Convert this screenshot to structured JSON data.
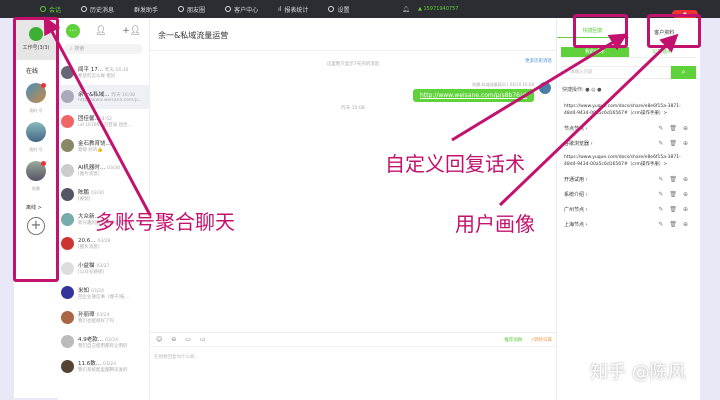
{
  "topbar": {
    "nav": [
      "会话",
      "历史消息",
      "群发助手",
      "朋友圈",
      "客户中心",
      "报表统计",
      "设置"
    ],
    "user": "15971940757"
  },
  "accounts": {
    "title": "工作号(3/3)",
    "online": "在线",
    "items": [
      "我的-号",
      "我的-号",
      "陈鹏"
    ],
    "more": "离线 >"
  },
  "contacts": {
    "search_placeholder": "搜索",
    "items": [
      {
        "name": "闻平 17...",
        "time": "昨天 16:30",
        "msg": "希望的怎么样 挺好"
      },
      {
        "name": "余一&私域...",
        "time": "昨天 16:08",
        "msg": "http://www.weisane.com/p..."
      },
      {
        "name": "团佳馨...",
        "time": "4:52",
        "msg": "ud 16166...已登录 团佳..."
      },
      {
        "name": "金石教育饶...",
        "time": "",
        "msg": "嗯嗯 好的👍"
      },
      {
        "name": "AI机器时...",
        "time": "03/30",
        "msg": "[图片消息]"
      },
      {
        "name": "陈鹏",
        "time": "03/30",
        "msg": "[视频]"
      },
      {
        "name": "大众新...",
        "time": "",
        "msg": "新兴趣的这类我可以无成功"
      },
      {
        "name": "20.6...",
        "time": "03/28",
        "msg": "[图片消息]"
      },
      {
        "name": "小益猫",
        "time": "03/27",
        "msg": "[公众号链接]"
      },
      {
        "name": "米知",
        "time": "03/24",
        "msg": "回企业微信事（端子/拓..."
      },
      {
        "name": "孙丽璋",
        "time": "03/24",
        "msg": "我们也挺很好了吗"
      },
      {
        "name": "4.9老款...",
        "time": "03/24",
        "msg": "我们自己使用都有让用的"
      },
      {
        "name": "11.6数...",
        "time": "03/24",
        "msg": "我们系统能里都腾讯发的"
      }
    ]
  },
  "chat": {
    "title": "余一&私域流量运营",
    "sys1": "这里暂只显示7天内的消息",
    "more": "更多历史消息",
    "sender": "陈鹏-私域流量顾问 | 04/20 16:08",
    "bubble": "http://www.weisane.com/p/s8b76/#",
    "sys2": "昨天 15:08",
    "recommend": "推荐加群",
    "transfer": "↗转移归属",
    "input_placeholder": "在想要回复你什么呢..."
  },
  "panel": {
    "tabs": [
      "快捷回复",
      "客户资料"
    ],
    "subtabs": [
      "我的话术",
      "公共话术"
    ],
    "search_placeholder": "请输入内容",
    "quick": "快捷操作:",
    "url1": "https://www.yuque.com/docs/share/e8e6f15a-3871-48d4-9434-00a5c6d16567#（crm操作手册）>",
    "items1": [
      "节点节点"
    ],
    "items2": [
      "谷歌浏览器"
    ],
    "url2": "https://www.yuque.com/docs/share/e8e6f15a-3871-48d4-9434-00a5c6d16567#（crm操作手册）>",
    "items3": [
      "开通试用",
      "系统介绍",
      "广州节点",
      "上海节点"
    ]
  },
  "annotations": {
    "left": "多账号聚合聊天",
    "mid": "自定义回复话术",
    "right": "用户画像"
  },
  "watermark": "知乎 @陈风",
  "colors": {
    "accent": "#5fd13a",
    "annotation": "#c2126e"
  }
}
